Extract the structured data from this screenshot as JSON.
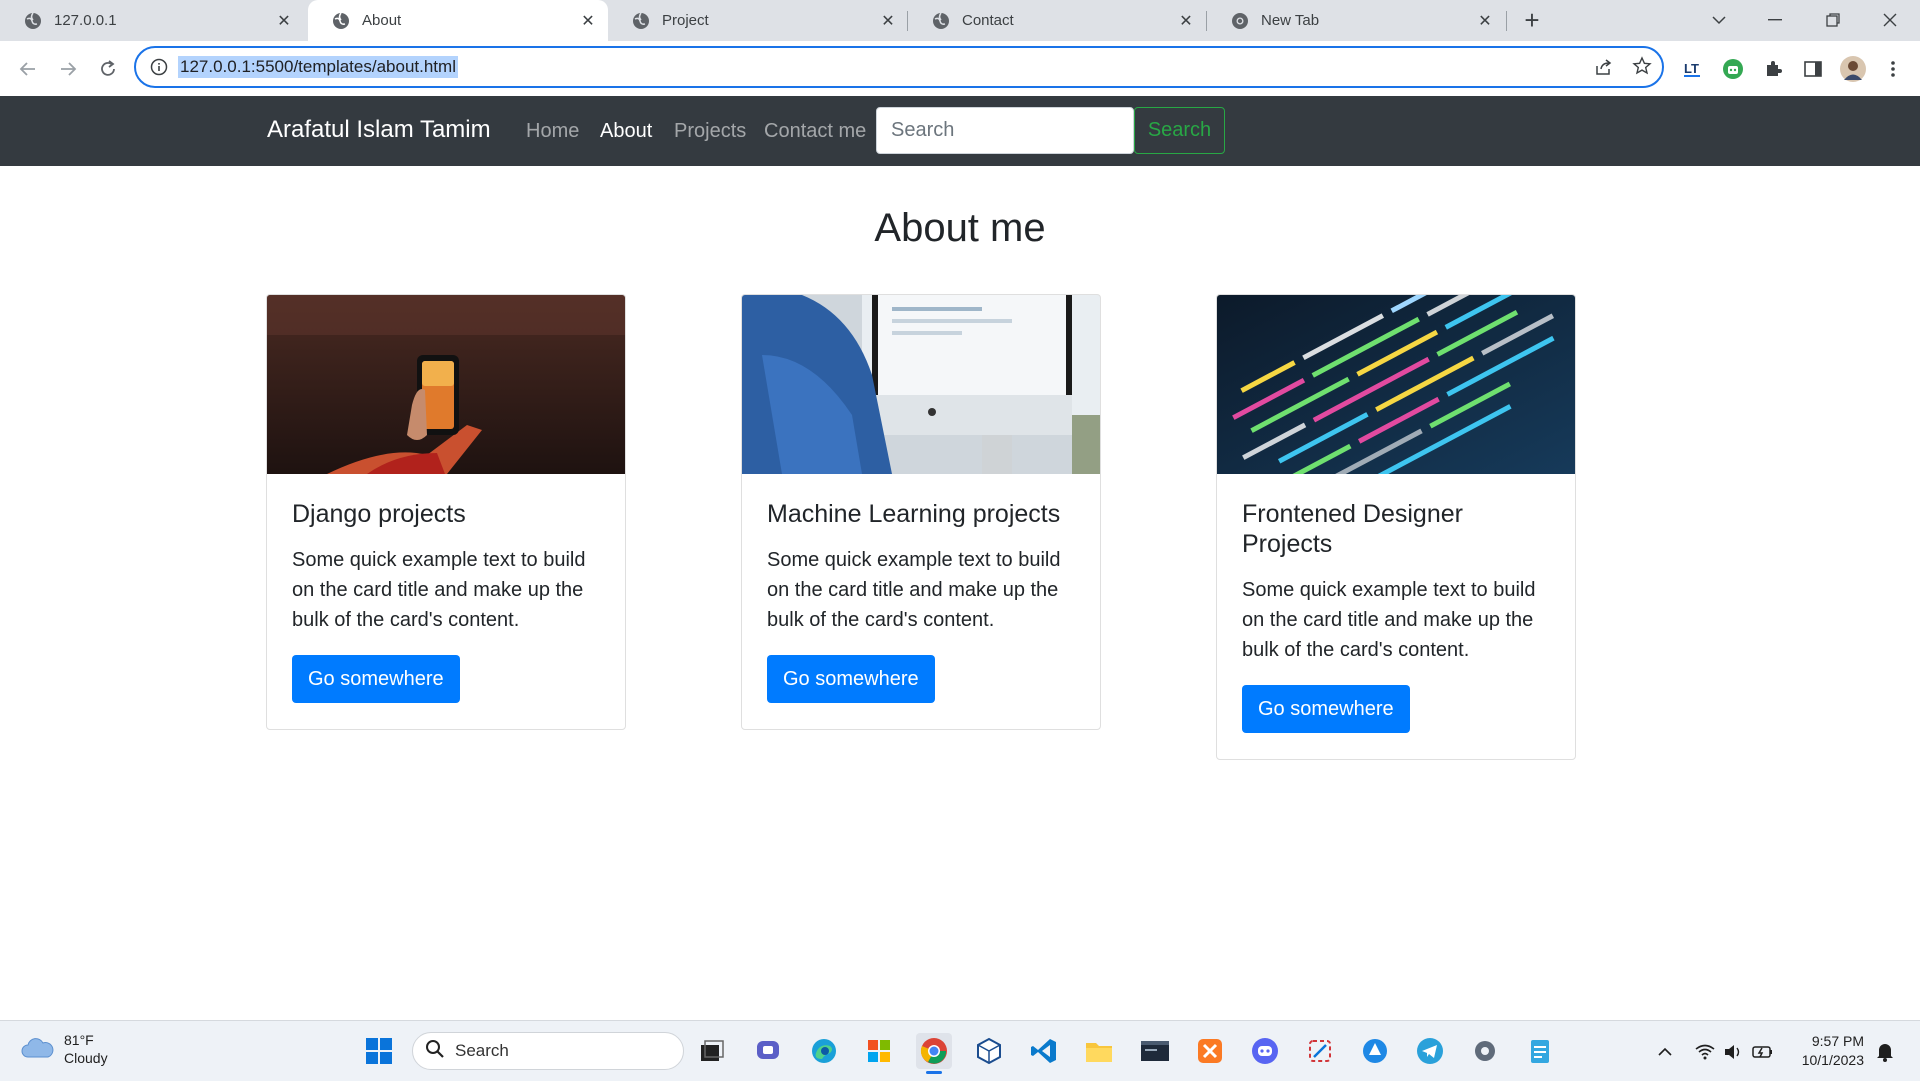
{
  "browser": {
    "tabs": [
      {
        "title": "127.0.0.1",
        "active": false
      },
      {
        "title": "About",
        "active": true
      },
      {
        "title": "Project",
        "active": false
      },
      {
        "title": "Contact",
        "active": false
      },
      {
        "title": "New Tab",
        "active": false
      }
    ],
    "address": "127.0.0.1:5500/templates/about.html"
  },
  "navbar": {
    "brand": "Arafatul Islam Tamim",
    "links": [
      {
        "label": "Home",
        "active": false
      },
      {
        "label": "About",
        "active": true
      },
      {
        "label": "Projects",
        "active": false
      },
      {
        "label": "Contact me",
        "active": false
      }
    ],
    "search_placeholder": "Search",
    "search_button": "Search"
  },
  "main": {
    "heading": "About me",
    "cards": [
      {
        "title": "Django projects",
        "text": "Some quick example text to build on the card title and make up the bulk of the card's content.",
        "button": "Go somewhere",
        "image": "phone-in-hand-photo"
      },
      {
        "title": "Machine Learning projects",
        "text": "Some quick example text to build on the card title and make up the bulk of the card's content.",
        "button": "Go somewhere",
        "image": "person-at-imac-photo"
      },
      {
        "title": "Frontened Designer Projects",
        "text": "Some quick example text to build on the card title and make up the bulk of the card's content.",
        "button": "Go somewhere",
        "image": "colorful-code-screen-photo"
      }
    ]
  },
  "taskbar": {
    "weather_temp": "81°F",
    "weather_desc": "Cloudy",
    "search_label": "Search",
    "time": "9:57 PM",
    "date": "10/1/2023"
  },
  "colors": {
    "navbar_bg": "#343a40",
    "primary": "#007bff",
    "success": "#28a745",
    "omnibox_focus": "#1a73e8"
  }
}
